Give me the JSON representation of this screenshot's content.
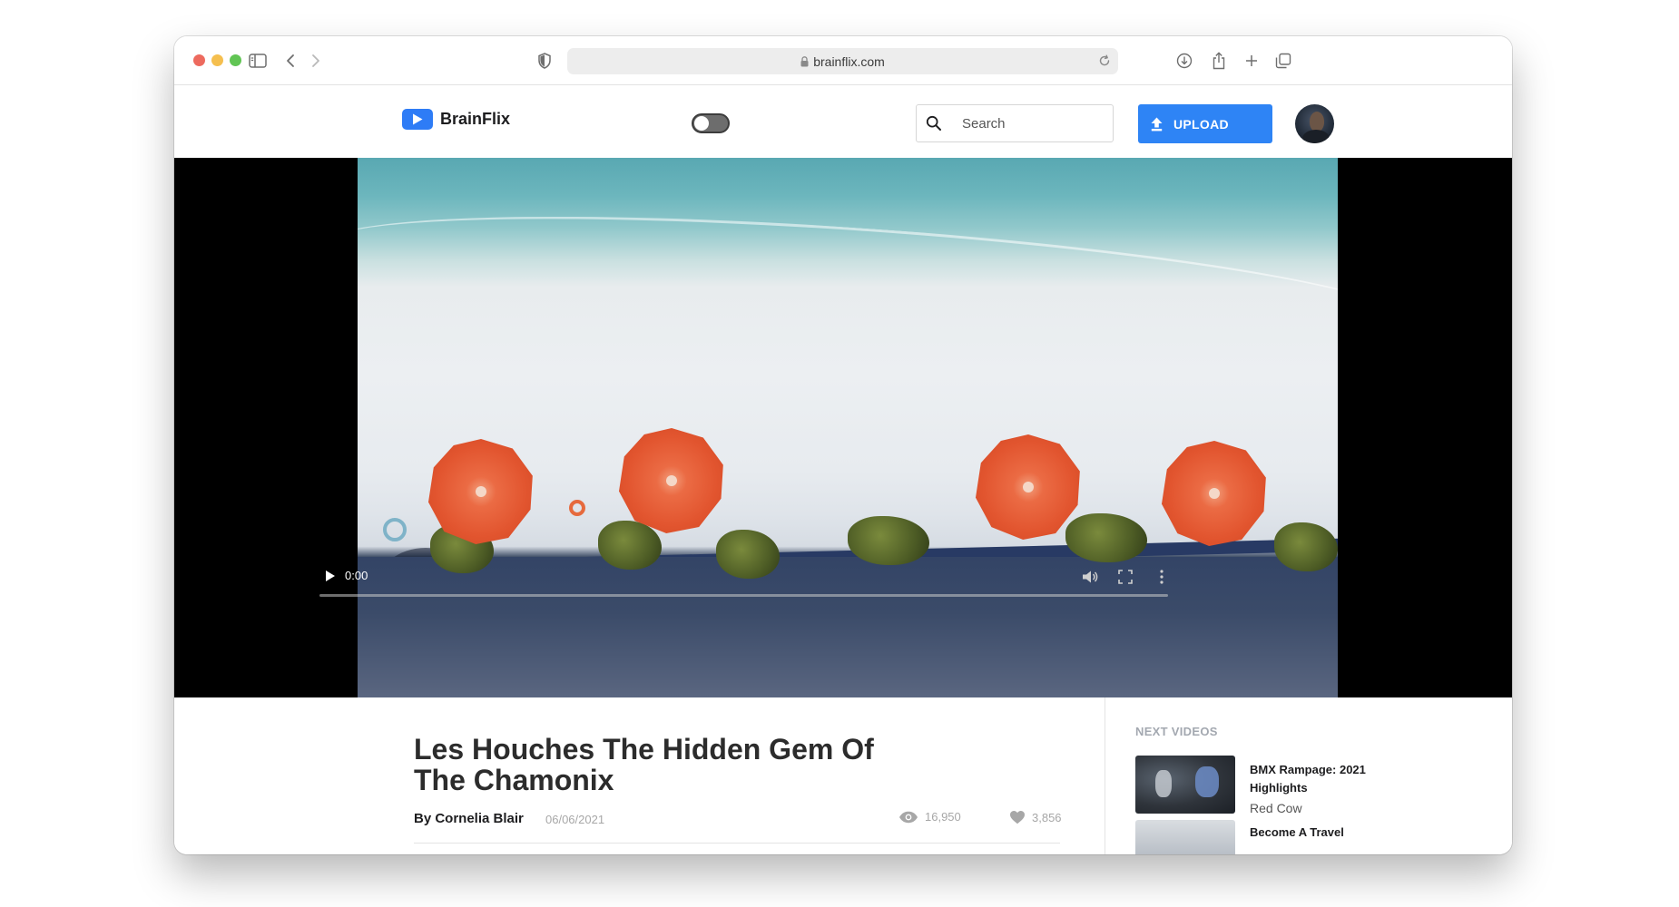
{
  "browser": {
    "url": "brainflix.com"
  },
  "header": {
    "brand": "BrainFlix",
    "search_placeholder": "Search",
    "upload_label": "UPLOAD"
  },
  "player": {
    "current_time": "0:00",
    "progress": 0.0
  },
  "video": {
    "title": "Les Houches The Hidden Gem Of The Chamonix",
    "author": "By Cornelia Blair",
    "date": "06/06/2021",
    "views": "16,950",
    "likes": "3,856"
  },
  "next_videos": {
    "heading": "NEXT VIDEOS",
    "items": [
      {
        "title": "BMX Rampage: 2021 Highlights",
        "channel": "Red Cow"
      },
      {
        "title": "Become A Travel",
        "channel": ""
      }
    ]
  },
  "colors": {
    "accent": "#2e84f5",
    "brand_logo": "#2e7cf6"
  }
}
